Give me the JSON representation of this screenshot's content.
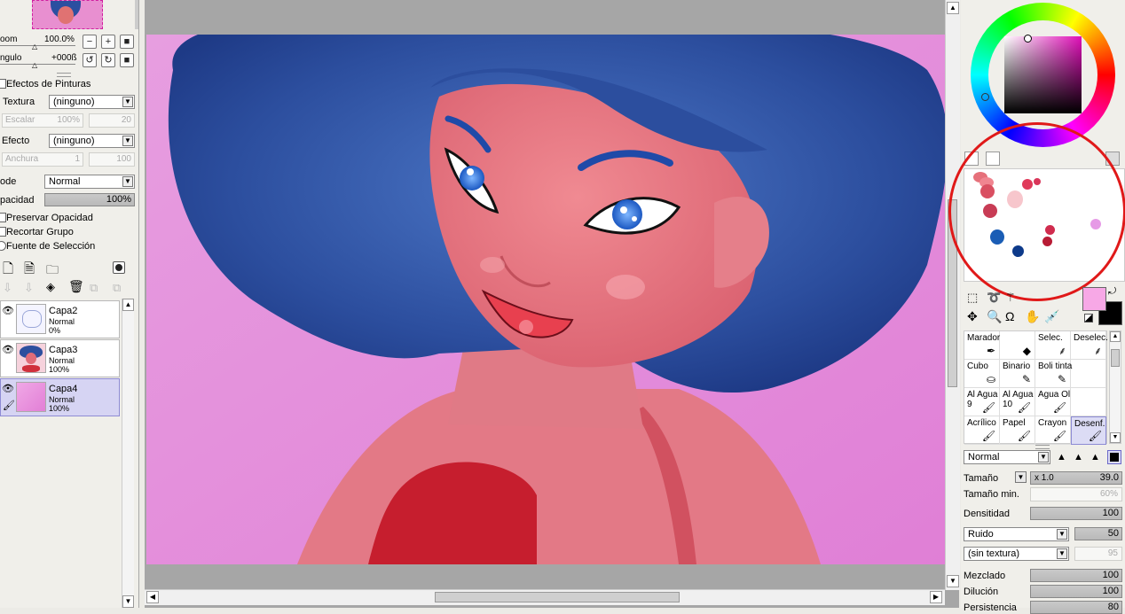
{
  "navigator": {
    "zoom_label": "oom",
    "zoom_value": "100.0%",
    "angle_label": "ngulo",
    "angle_value": "+000ß"
  },
  "paint_effects": {
    "title": "Efectos de Pinturas",
    "texture_label": "Textura",
    "texture_value": "(ninguno)",
    "scale_label": "Escalar",
    "scale_value": "100%",
    "scale_num": "20",
    "effect_label": "Efecto",
    "effect_value": "(ninguno)",
    "width_label": "Anchura",
    "width_value": "1",
    "width_num": "100"
  },
  "layer_props": {
    "mode_label": "ode",
    "mode_value": "Normal",
    "opacity_label": "pacidad",
    "opacity_value": "100%",
    "preserve_opacity": "Preservar Opacidad",
    "clip_group": "Recortar Grupo",
    "selection_source": "Fuente de Selección"
  },
  "layers": [
    {
      "name": "Capa2",
      "mode": "Normal",
      "opacity": "0%",
      "selected": false
    },
    {
      "name": "Capa3",
      "mode": "Normal",
      "opacity": "100%",
      "selected": false
    },
    {
      "name": "Capa4",
      "mode": "Normal",
      "opacity": "100%",
      "selected": true
    }
  ],
  "tools": [
    {
      "label": "Marador",
      "icon": "pen-icon"
    },
    {
      "label": "",
      "icon": "eraser-icon"
    },
    {
      "label": "Selec.",
      "icon": "select-pen-icon"
    },
    {
      "label": "Deselec.",
      "icon": "deselect-icon"
    },
    {
      "label": "Cubo",
      "icon": "bucket-icon"
    },
    {
      "label": "Binario",
      "icon": "binary-pen-icon"
    },
    {
      "label": "Boli tinta",
      "icon": "ink-pen-icon"
    },
    {
      "label": "",
      "icon": ""
    },
    {
      "label": "Al Agua\n9",
      "icon": "brush-icon"
    },
    {
      "label": "Al Agua\n10",
      "icon": "brush-icon"
    },
    {
      "label": "Agua Ol",
      "icon": "brush-icon"
    },
    {
      "label": "",
      "icon": ""
    },
    {
      "label": "Acrílico",
      "icon": "brush-icon"
    },
    {
      "label": "Papel",
      "icon": "brush-icon"
    },
    {
      "label": "Crayon",
      "icon": "brush-icon"
    },
    {
      "label": "Desenf.",
      "icon": "blur-icon"
    }
  ],
  "brush": {
    "blend_mode": "Normal",
    "size_label": "Tamaño",
    "size_mult": "x 1.0",
    "size_value": "39.0",
    "min_size_label": "Tamaño min.",
    "min_size_value": "60%",
    "density_label": "Densitidad",
    "density_value": "100",
    "noise_select": "Ruido",
    "noise_value": "50",
    "texture_select": "(sin textura)",
    "texture_value": "95",
    "blending_label": "Mezclado",
    "blending_value": "100",
    "dilution_label": "Dilución",
    "dilution_value": "100",
    "persistence_label": "Persistencia",
    "persistence_value": "80"
  },
  "colors": {
    "primary": "#f7a8e6",
    "secondary": "#000000",
    "swatches": [
      "#e6707a",
      "#f08590",
      "#d94f61",
      "#e03a5a",
      "#d9365a",
      "#f7c6cc",
      "#c83c55",
      "#1a5db5",
      "#0d3a8a",
      "#d02c4e",
      "#b81c35",
      "#e69ae6"
    ]
  }
}
